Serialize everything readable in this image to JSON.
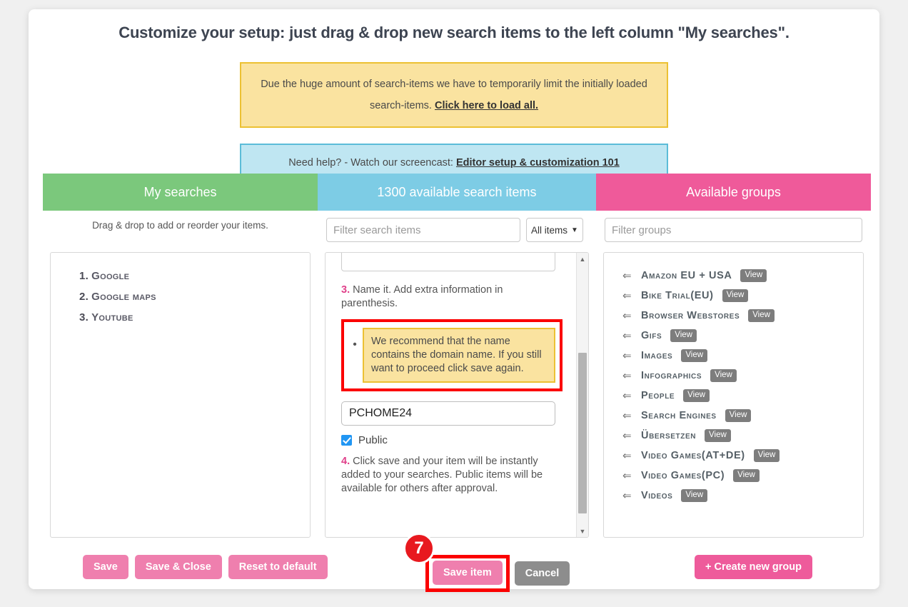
{
  "page": {
    "title": "Customize your setup: just drag & drop new search items to the left column \"My searches\"."
  },
  "notices": {
    "yellow": {
      "text": "Due the huge amount of search-items we have to temporarily limit the initially loaded search-items. ",
      "link": "Click here to load all.",
      "bg": "#fae3a0",
      "border": "#ecc133"
    },
    "blue": {
      "text": "Need help? - Watch our screencast: ",
      "link": "Editor setup & customization 101",
      "bg": "#bfe6f2",
      "border": "#5cbcd8"
    }
  },
  "columns": {
    "left": {
      "header": "My searches",
      "header_color": "#7bc87c",
      "hint": "Drag & drop to add or reorder your items.",
      "items": [
        {
          "num": "1.",
          "name": "Google"
        },
        {
          "num": "2.",
          "name": "Google maps"
        },
        {
          "num": "3.",
          "name": "Youtube"
        }
      ]
    },
    "middle": {
      "header": "1300 available search items",
      "header_color": "#7dcce5",
      "filter_placeholder": "Filter search items",
      "filter_value": "",
      "select_value": "All items",
      "textarea_value": "",
      "step3": {
        "num": "3.",
        "text": " Name it. Add extra information in parenthesis."
      },
      "recommendation": "We recommend that the name contains the domain name. If you still want to proceed click save again.",
      "name_input_value": "PCHOME24",
      "public_label": "Public",
      "public_checked": true,
      "step4": {
        "num": "4.",
        "text": " Click save and your item will be instantly added to your searches. Public items will be available for others after approval."
      }
    },
    "right": {
      "header": "Available groups",
      "header_color": "#ef5a9a",
      "filter_placeholder": "Filter groups",
      "filter_value": "",
      "view_label": "View",
      "groups": [
        "Amazon EU + USA",
        "Bike Trial(EU)",
        "Browser Webstores",
        "Gifs",
        "Images",
        "Infographics",
        "People",
        "Search Engines",
        "Übersetzen",
        "Video Games(AT+DE)",
        "Video Games(PC)",
        "Videos"
      ]
    }
  },
  "footer": {
    "save": "Save",
    "save_close": "Save & Close",
    "reset": "Reset to default",
    "save_item": "Save item",
    "cancel": "Cancel",
    "create_group": "+ Create new group",
    "step_badge": "7"
  }
}
